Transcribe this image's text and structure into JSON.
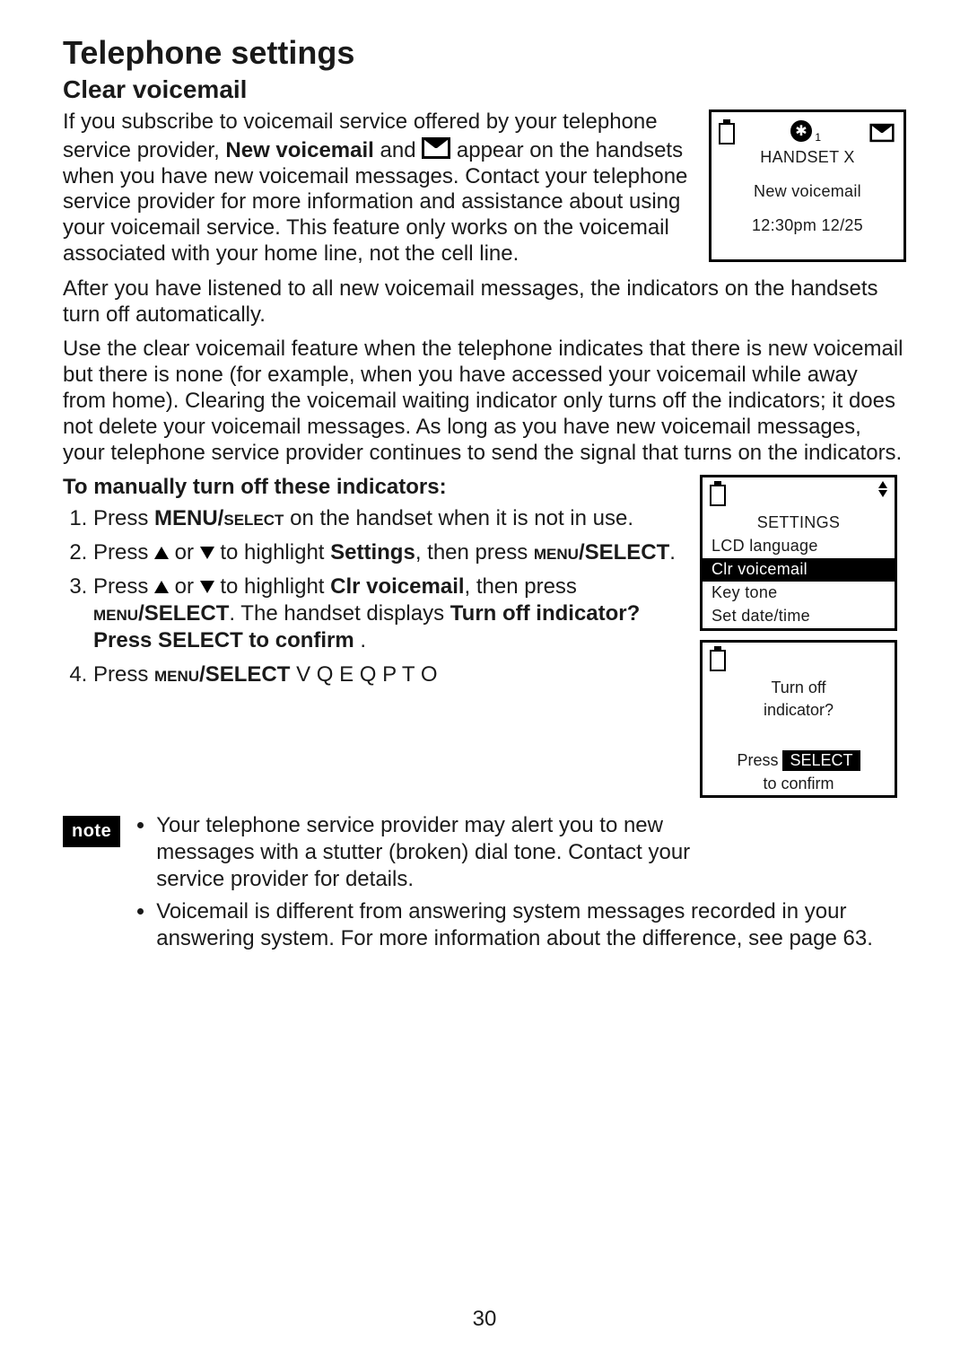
{
  "page": {
    "number": "30",
    "title": "Telephone settings",
    "section": "Clear voicemail"
  },
  "intro": {
    "p1a": "If you subscribe to voicemail service offered by your telephone service provider, ",
    "p1_new": "New voicemail",
    "p1b": " and ",
    "p1c": " appear on the handsets when you have new voicemail messages. Contact your telephone service provider for more information and assistance about using your voicemail service. This feature only works on the voicemail associated with your home line, not the cell line.",
    "p2": "After you have listened to all new voicemail messages, the indicators on the handsets turn off automatically.",
    "p3": "Use the clear voicemail feature when the telephone indicates that there is new voicemail but there is none (for example, when you have accessed your voicemail while away from home). Clearing the voicemail waiting indicator only turns off the indicators; it does not delete your voicemail messages. As long as you have new voicemail messages, your telephone service provider continues to send the signal that turns on the indicators."
  },
  "screen1": {
    "handset": "HANDSET X",
    "status": "New voicemail",
    "time": "12:30pm  12/25"
  },
  "steps": {
    "heading": "To manually turn off these indicators:",
    "s1a": "Press ",
    "s1menu": "MENU/",
    "s1sel": "select",
    "s1b": " on the handset when it is not in use.",
    "s2a": "Press ",
    "s2b": " or ",
    "s2c": " to highlight ",
    "s2settings": "Settings",
    "s2d": ", then press ",
    "s2menu": "menu",
    "s2sel": "/SELECT",
    "s2e": ".",
    "s3a": "Press ",
    "s3b": " or ",
    "s3c": " to highlight ",
    "s3clr": "Clr voicemail",
    "s3d": ", then press ",
    "s3menu": "menu",
    "s3sel": "/SELECT",
    "s3e": ". The handset displays ",
    "s3turn": "Turn off indicator?   Press SELECT to confirm",
    "s3f": "  .",
    "s4a": "Press ",
    "s4menu": "menu",
    "s4sel": "/SELECT",
    "s4b": "  V Q   E Q P   T O"
  },
  "screen2": {
    "title": "SETTINGS",
    "items": [
      "LCD language",
      "Clr voicemail",
      "Key tone",
      "Set date/time"
    ]
  },
  "screen3": {
    "l1": "Turn off",
    "l2": "indicator?",
    "press": "Press ",
    "select": "SELECT",
    "confirm": "to confirm"
  },
  "notes": {
    "label": "note",
    "n1": "Your telephone service provider may alert you to new messages with a stutter (broken) dial tone. Contact your service provider for details.",
    "n2": "Voicemail is different from answering system messages recorded in your answering system. For more information about the difference, see page 63."
  }
}
